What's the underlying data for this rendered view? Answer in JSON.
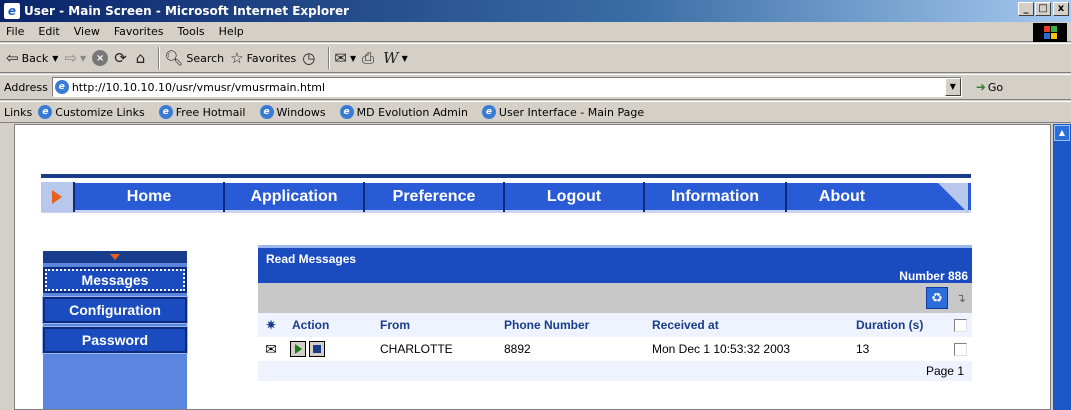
{
  "window": {
    "title": "User - Main Screen - Microsoft Internet Explorer",
    "min_label": "_",
    "max_label": "□",
    "close_label": "x"
  },
  "menu": [
    "File",
    "Edit",
    "View",
    "Favorites",
    "Tools",
    "Help"
  ],
  "toolbar": {
    "back_label": "Back",
    "search_label": "Search",
    "favorites_label": "Favorites"
  },
  "address": {
    "label": "Address",
    "url": "http://10.10.10.10/usr/vmusr/vmusrmain.html",
    "go_label": "Go"
  },
  "links": {
    "label": "Links",
    "items": [
      "Customize Links",
      "Free Hotmail",
      "Windows",
      "MD Evolution Admin",
      "User Interface - Main Page"
    ]
  },
  "nav": {
    "items": [
      "Home",
      "Application",
      "Preference",
      "Logout",
      "Information",
      "About"
    ]
  },
  "sidebar": {
    "items": [
      "Messages",
      "Configuration",
      "Password"
    ],
    "active": "Messages"
  },
  "messages": {
    "title": "Read Messages",
    "number_label": "Number 886",
    "columns": {
      "action": "Action",
      "from": "From",
      "phone": "Phone Number",
      "received": "Received at",
      "duration": "Duration (s)"
    },
    "rows": [
      {
        "from": "CHARLOTTE",
        "phone": "8892",
        "received": "Mon Dec 1 10:53:32 2003",
        "duration": "13"
      }
    ],
    "page_label": "Page 1"
  },
  "colors": {
    "accent": "#2a5bd7",
    "nav_dark": "#1a3c8c",
    "arrow": "#e8601c"
  }
}
